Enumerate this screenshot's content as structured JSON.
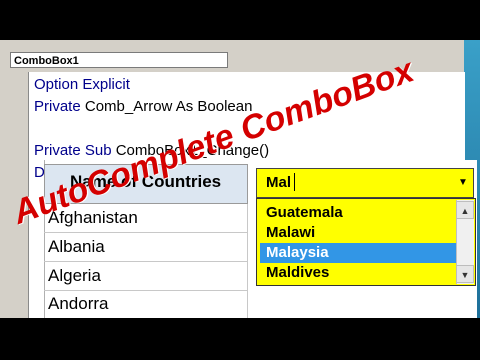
{
  "editor": {
    "object_name": "ComboBox1",
    "code_lines": [
      {
        "kw": "Option Explicit",
        "rest": ""
      },
      {
        "kw": "Private ",
        "rest": "Comb_Arrow As Boolean"
      },
      {
        "kw": "",
        "rest": ""
      },
      {
        "kw": "Private Sub ",
        "rest": "ComboBox1_Change()"
      },
      {
        "kw": "D",
        "rest": ""
      }
    ]
  },
  "sheet": {
    "header": "Name of Countries",
    "rows": [
      "Afghanistan",
      "Albania",
      "Algeria",
      "Andorra"
    ]
  },
  "combobox": {
    "value": "Mal",
    "arrow_icon": "chevron-down-icon",
    "items": [
      "Guatemala",
      "Malawi",
      "Malaysia",
      "Maldives"
    ],
    "selected": "Malaysia",
    "colors": {
      "background": "#ffff00",
      "selected": "#3296e6"
    }
  },
  "overlay": {
    "title": "AutoComplete ComboBox",
    "color": "#d40000"
  }
}
